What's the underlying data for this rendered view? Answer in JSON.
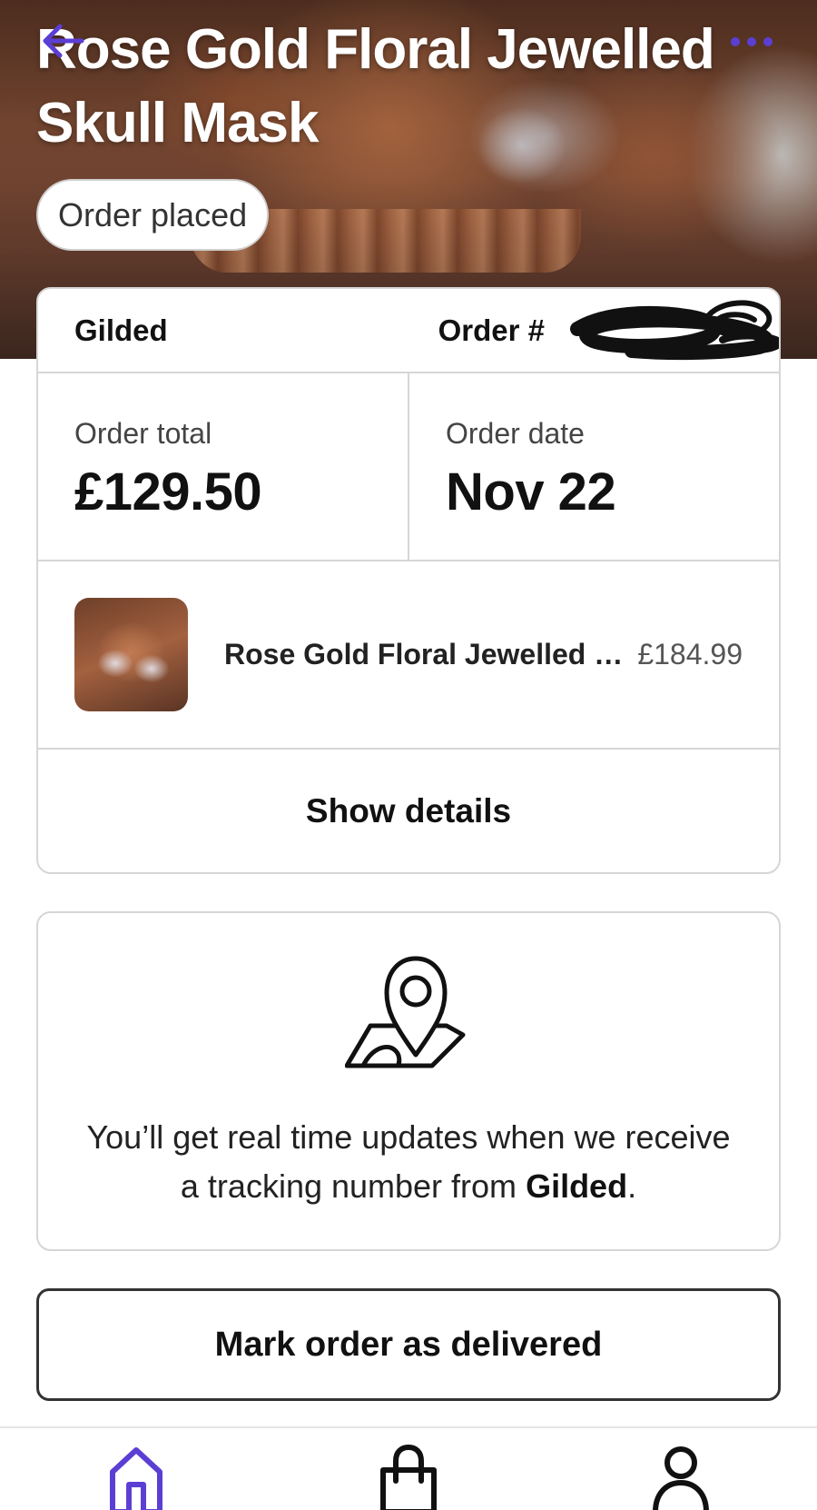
{
  "header": {
    "title": "Rose Gold Floral Jewelled Skull Mask",
    "status": "Order placed",
    "back_icon": "arrow-left-icon",
    "more_icon": "more-horizontal-icon"
  },
  "order": {
    "shop_name": "Gilded",
    "order_number_label": "Order #",
    "total_label": "Order total",
    "total_value": "£129.50",
    "date_label": "Order date",
    "date_value": "Nov 22"
  },
  "item": {
    "name": "Rose Gold Floral Jewelled Skull Mask",
    "price": "£184.99"
  },
  "details_button": "Show details",
  "tracking": {
    "text_before": "You’ll get real time updates when we receive a tracking number from ",
    "shop": "Gilded",
    "text_after": "."
  },
  "mark_delivered_button": "Mark order as delivered",
  "nav": {
    "items": [
      {
        "icon": "home-icon",
        "active": true
      },
      {
        "icon": "shopping-bag-icon",
        "active": false
      },
      {
        "icon": "profile-icon",
        "active": false
      }
    ]
  },
  "colors": {
    "accent": "#5b3fd4",
    "text": "#111111",
    "border": "#d6d6d6"
  }
}
